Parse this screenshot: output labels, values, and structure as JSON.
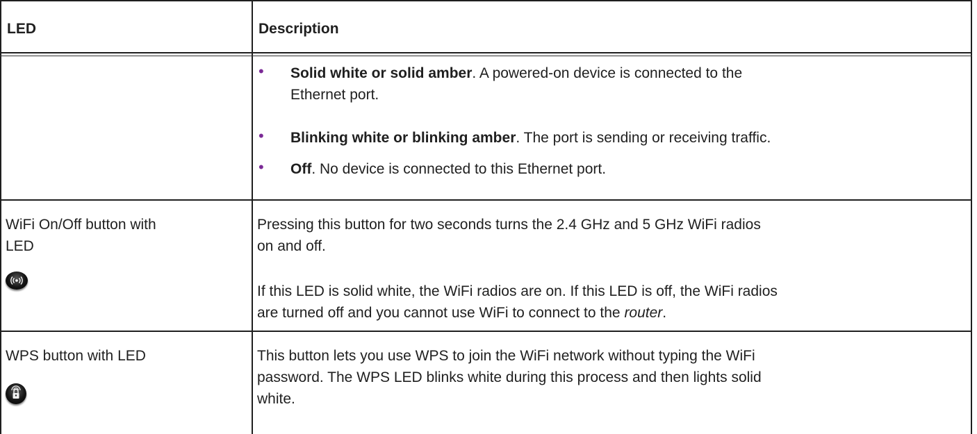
{
  "header": {
    "led_label": "LED",
    "description_label": "Description"
  },
  "rows": [
    {
      "bullets": [
        {
          "bold": "Solid white or solid amber",
          "text": ". A powered-on device is connected to the",
          "text2": "Ethernet port."
        },
        {
          "bold": "Blinking white or blinking amber",
          "text": ". The port is sending or receiving traffic."
        },
        {
          "bold": "Off",
          "text": ". No device is connected to this Ethernet port."
        }
      ]
    },
    {
      "led_line1": "WiFi On/Off button with",
      "led_line2": "LED",
      "icon": "wifi-radio-icon",
      "desc_p1_line1": "Pressing this button for two seconds turns the 2.4 GHz and 5 GHz WiFi radios",
      "desc_p1_line2": "on and off.",
      "desc_p2_line1": "If this LED is solid white, the WiFi radios are on. If this LED is off, the WiFi radios",
      "desc_p2_line2_pre": "are turned off and you cannot use WiFi to connect to the ",
      "desc_p2_line2_italic": "router",
      "desc_p2_line2_post": "."
    },
    {
      "led_line1": "WPS button with LED",
      "icon": "wps-lock-icon",
      "desc_line1": "This button lets you use WPS to join the WiFi network without typing the WiFi",
      "desc_line2": "password. The WPS LED blinks white during this process and then lights solid",
      "desc_line3": "white."
    }
  ]
}
